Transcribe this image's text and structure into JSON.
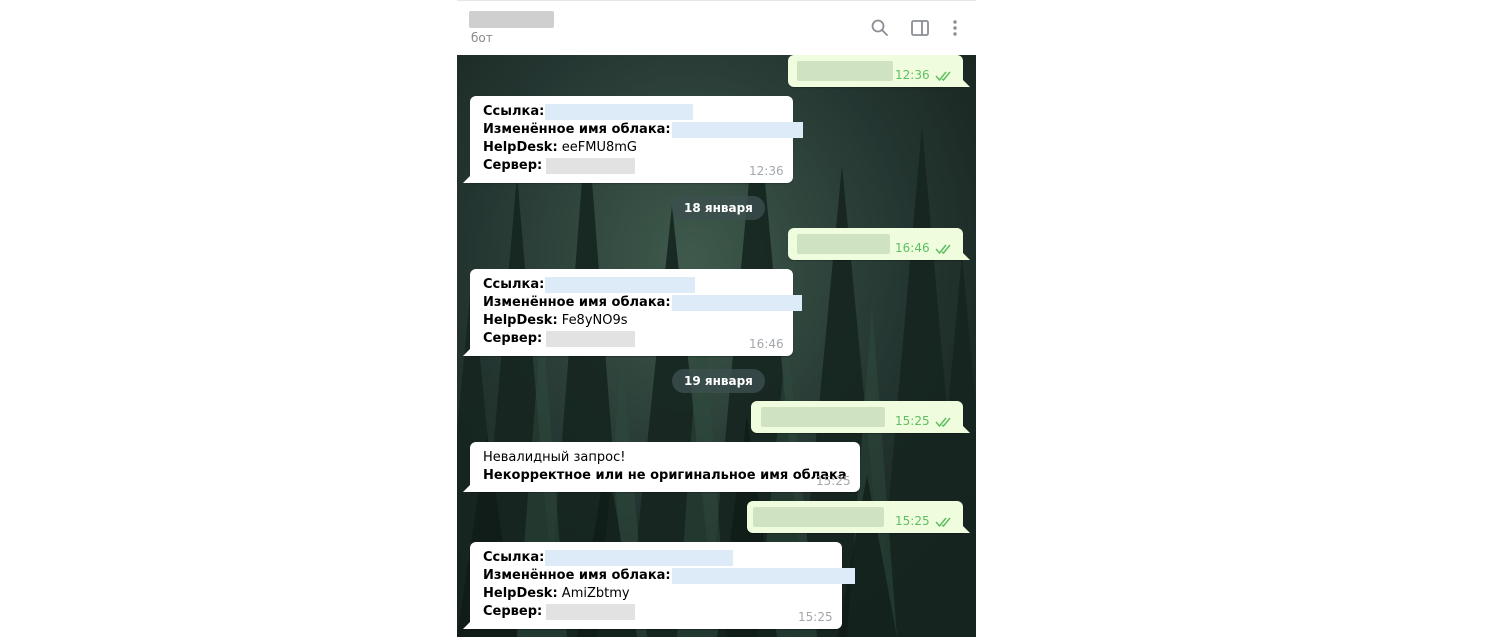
{
  "header": {
    "subtitle": "бот"
  },
  "dates": [
    "18 января",
    "19 января"
  ],
  "labels": {
    "link": "Ссылка:",
    "cloud_name": "Изменённое имя облака:",
    "helpdesk": "HelpDesk:",
    "server": "Сервер:"
  },
  "messages": {
    "out1_time": "12:36",
    "in1": {
      "helpdesk": "eeFMU8mG",
      "time": "12:36"
    },
    "out2_time": "16:46",
    "in2": {
      "helpdesk": "Fe8yNO9s",
      "time": "16:46"
    },
    "out3_time": "15:25",
    "in3": {
      "line1": "Невалидный запрос!",
      "line2": "Некорректное или не оригинальное имя облака",
      "time": "15:25"
    },
    "out4_time": "15:25",
    "in4": {
      "helpdesk": "AmiZbtmy",
      "time": "15:25"
    }
  },
  "colors": {
    "outgoing_bubble": "#effdde",
    "incoming_bubble": "#ffffff",
    "read_ticks": "#5fbf60"
  }
}
